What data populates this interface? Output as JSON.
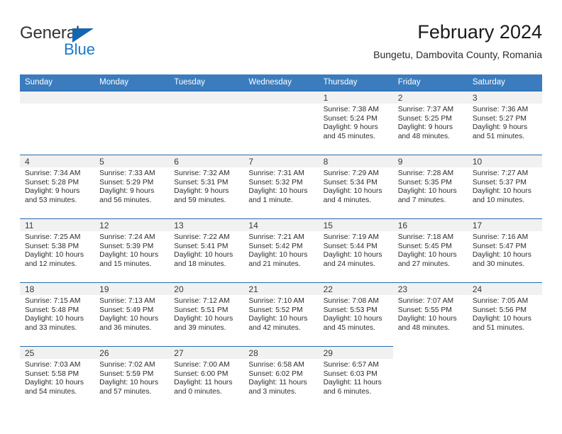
{
  "brand": {
    "name_top": "General",
    "name_bottom": "Blue",
    "triangle_color": "#1366b0",
    "blue_color": "#1b78c8"
  },
  "header": {
    "title": "February 2024",
    "subtitle": "Bungetu, Dambovita County, Romania"
  },
  "theme": {
    "header_bg": "#3a7cbe",
    "row_rule": "#2a6aac",
    "daynum_bg": "#f1f1f1",
    "text": "#2d2d2d"
  },
  "calendar": {
    "weekday_headers": [
      "Sunday",
      "Monday",
      "Tuesday",
      "Wednesday",
      "Thursday",
      "Friday",
      "Saturday"
    ],
    "labels": {
      "sunrise": "Sunrise:",
      "sunset": "Sunset:",
      "daylight": "Daylight:"
    },
    "weeks": [
      [
        {
          "day": "",
          "blank": true
        },
        {
          "day": "",
          "blank": true
        },
        {
          "day": "",
          "blank": true
        },
        {
          "day": "",
          "blank": true
        },
        {
          "day": "1",
          "sunrise": "Sunrise: 7:38 AM",
          "sunset": "Sunset: 5:24 PM",
          "daylight_1": "Daylight: 9 hours",
          "daylight_2": "and 45 minutes."
        },
        {
          "day": "2",
          "sunrise": "Sunrise: 7:37 AM",
          "sunset": "Sunset: 5:25 PM",
          "daylight_1": "Daylight: 9 hours",
          "daylight_2": "and 48 minutes."
        },
        {
          "day": "3",
          "sunrise": "Sunrise: 7:36 AM",
          "sunset": "Sunset: 5:27 PM",
          "daylight_1": "Daylight: 9 hours",
          "daylight_2": "and 51 minutes."
        }
      ],
      [
        {
          "day": "4",
          "sunrise": "Sunrise: 7:34 AM",
          "sunset": "Sunset: 5:28 PM",
          "daylight_1": "Daylight: 9 hours",
          "daylight_2": "and 53 minutes."
        },
        {
          "day": "5",
          "sunrise": "Sunrise: 7:33 AM",
          "sunset": "Sunset: 5:29 PM",
          "daylight_1": "Daylight: 9 hours",
          "daylight_2": "and 56 minutes."
        },
        {
          "day": "6",
          "sunrise": "Sunrise: 7:32 AM",
          "sunset": "Sunset: 5:31 PM",
          "daylight_1": "Daylight: 9 hours",
          "daylight_2": "and 59 minutes."
        },
        {
          "day": "7",
          "sunrise": "Sunrise: 7:31 AM",
          "sunset": "Sunset: 5:32 PM",
          "daylight_1": "Daylight: 10 hours",
          "daylight_2": "and 1 minute."
        },
        {
          "day": "8",
          "sunrise": "Sunrise: 7:29 AM",
          "sunset": "Sunset: 5:34 PM",
          "daylight_1": "Daylight: 10 hours",
          "daylight_2": "and 4 minutes."
        },
        {
          "day": "9",
          "sunrise": "Sunrise: 7:28 AM",
          "sunset": "Sunset: 5:35 PM",
          "daylight_1": "Daylight: 10 hours",
          "daylight_2": "and 7 minutes."
        },
        {
          "day": "10",
          "sunrise": "Sunrise: 7:27 AM",
          "sunset": "Sunset: 5:37 PM",
          "daylight_1": "Daylight: 10 hours",
          "daylight_2": "and 10 minutes."
        }
      ],
      [
        {
          "day": "11",
          "sunrise": "Sunrise: 7:25 AM",
          "sunset": "Sunset: 5:38 PM",
          "daylight_1": "Daylight: 10 hours",
          "daylight_2": "and 12 minutes."
        },
        {
          "day": "12",
          "sunrise": "Sunrise: 7:24 AM",
          "sunset": "Sunset: 5:39 PM",
          "daylight_1": "Daylight: 10 hours",
          "daylight_2": "and 15 minutes."
        },
        {
          "day": "13",
          "sunrise": "Sunrise: 7:22 AM",
          "sunset": "Sunset: 5:41 PM",
          "daylight_1": "Daylight: 10 hours",
          "daylight_2": "and 18 minutes."
        },
        {
          "day": "14",
          "sunrise": "Sunrise: 7:21 AM",
          "sunset": "Sunset: 5:42 PM",
          "daylight_1": "Daylight: 10 hours",
          "daylight_2": "and 21 minutes."
        },
        {
          "day": "15",
          "sunrise": "Sunrise: 7:19 AM",
          "sunset": "Sunset: 5:44 PM",
          "daylight_1": "Daylight: 10 hours",
          "daylight_2": "and 24 minutes."
        },
        {
          "day": "16",
          "sunrise": "Sunrise: 7:18 AM",
          "sunset": "Sunset: 5:45 PM",
          "daylight_1": "Daylight: 10 hours",
          "daylight_2": "and 27 minutes."
        },
        {
          "day": "17",
          "sunrise": "Sunrise: 7:16 AM",
          "sunset": "Sunset: 5:47 PM",
          "daylight_1": "Daylight: 10 hours",
          "daylight_2": "and 30 minutes."
        }
      ],
      [
        {
          "day": "18",
          "sunrise": "Sunrise: 7:15 AM",
          "sunset": "Sunset: 5:48 PM",
          "daylight_1": "Daylight: 10 hours",
          "daylight_2": "and 33 minutes."
        },
        {
          "day": "19",
          "sunrise": "Sunrise: 7:13 AM",
          "sunset": "Sunset: 5:49 PM",
          "daylight_1": "Daylight: 10 hours",
          "daylight_2": "and 36 minutes."
        },
        {
          "day": "20",
          "sunrise": "Sunrise: 7:12 AM",
          "sunset": "Sunset: 5:51 PM",
          "daylight_1": "Daylight: 10 hours",
          "daylight_2": "and 39 minutes."
        },
        {
          "day": "21",
          "sunrise": "Sunrise: 7:10 AM",
          "sunset": "Sunset: 5:52 PM",
          "daylight_1": "Daylight: 10 hours",
          "daylight_2": "and 42 minutes."
        },
        {
          "day": "22",
          "sunrise": "Sunrise: 7:08 AM",
          "sunset": "Sunset: 5:53 PM",
          "daylight_1": "Daylight: 10 hours",
          "daylight_2": "and 45 minutes."
        },
        {
          "day": "23",
          "sunrise": "Sunrise: 7:07 AM",
          "sunset": "Sunset: 5:55 PM",
          "daylight_1": "Daylight: 10 hours",
          "daylight_2": "and 48 minutes."
        },
        {
          "day": "24",
          "sunrise": "Sunrise: 7:05 AM",
          "sunset": "Sunset: 5:56 PM",
          "daylight_1": "Daylight: 10 hours",
          "daylight_2": "and 51 minutes."
        }
      ],
      [
        {
          "day": "25",
          "sunrise": "Sunrise: 7:03 AM",
          "sunset": "Sunset: 5:58 PM",
          "daylight_1": "Daylight: 10 hours",
          "daylight_2": "and 54 minutes."
        },
        {
          "day": "26",
          "sunrise": "Sunrise: 7:02 AM",
          "sunset": "Sunset: 5:59 PM",
          "daylight_1": "Daylight: 10 hours",
          "daylight_2": "and 57 minutes."
        },
        {
          "day": "27",
          "sunrise": "Sunrise: 7:00 AM",
          "sunset": "Sunset: 6:00 PM",
          "daylight_1": "Daylight: 11 hours",
          "daylight_2": "and 0 minutes."
        },
        {
          "day": "28",
          "sunrise": "Sunrise: 6:58 AM",
          "sunset": "Sunset: 6:02 PM",
          "daylight_1": "Daylight: 11 hours",
          "daylight_2": "and 3 minutes."
        },
        {
          "day": "29",
          "sunrise": "Sunrise: 6:57 AM",
          "sunset": "Sunset: 6:03 PM",
          "daylight_1": "Daylight: 11 hours",
          "daylight_2": "and 6 minutes."
        },
        {
          "day": "",
          "blank": true,
          "trailing": true
        },
        {
          "day": "",
          "blank": true,
          "trailing": true
        }
      ]
    ]
  }
}
